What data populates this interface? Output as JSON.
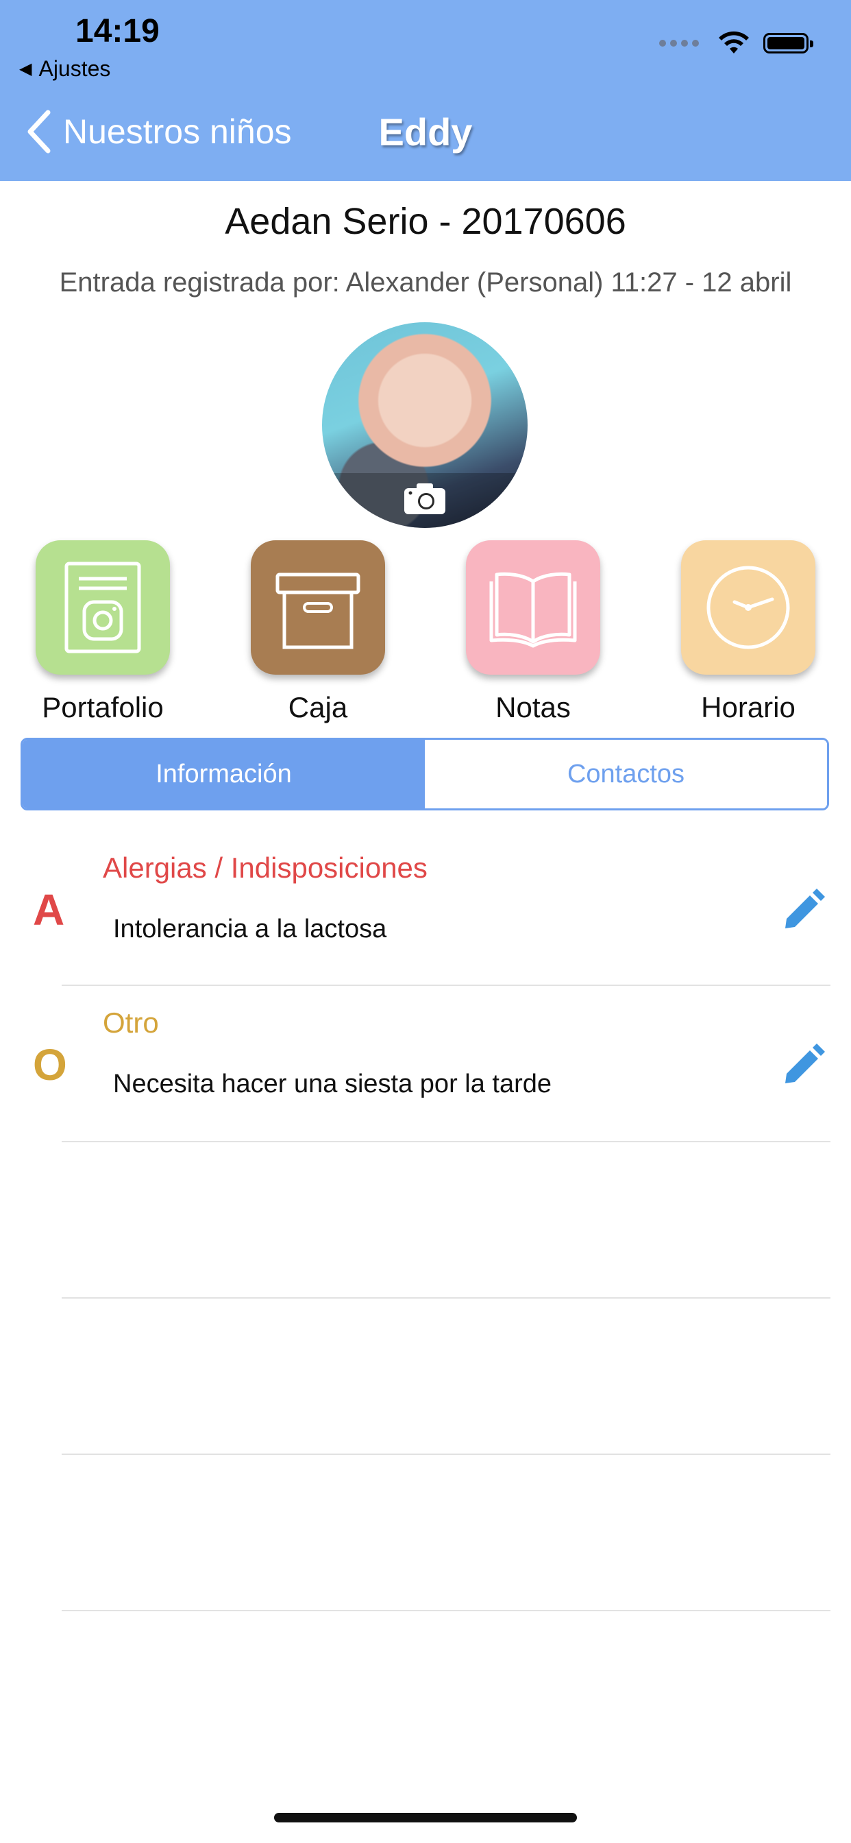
{
  "status_bar": {
    "time": "14:19",
    "back_app_label": "Ajustes",
    "icons": [
      "signal-dots-icon",
      "wifi-icon",
      "battery-icon"
    ]
  },
  "nav": {
    "back_label": "Nuestros niños",
    "title": "Eddy"
  },
  "child": {
    "name": "Aedan Serio - 20170606",
    "entry_text": "Entrada registrada por: Alexander (Personal) 11:27 - 12 abril"
  },
  "tiles": [
    {
      "label": "Portafolio",
      "icon": "portfolio-icon",
      "color": "#b6e090"
    },
    {
      "label": "Caja",
      "icon": "box-icon",
      "color": "#a87d52"
    },
    {
      "label": "Notas",
      "icon": "book-icon",
      "color": "#f9b5c0"
    },
    {
      "label": "Horario",
      "icon": "clock-icon",
      "color": "#f8d6a0"
    }
  ],
  "tabs": [
    {
      "label": "Información",
      "active": true
    },
    {
      "label": "Contactos",
      "active": false
    }
  ],
  "info_rows": [
    {
      "letter": "A",
      "category": "Alergias / Indisposiciones",
      "text": "Intolerancia a la lactosa",
      "color": "#e04848"
    },
    {
      "letter": "O",
      "category": "Otro",
      "text": "Necesita hacer una siesta por la tarde",
      "color": "#d4a43a"
    }
  ],
  "colors": {
    "nav_bar": "#7eaef2",
    "accent": "#6ea0ee",
    "edit_icon": "#3f96e0"
  }
}
